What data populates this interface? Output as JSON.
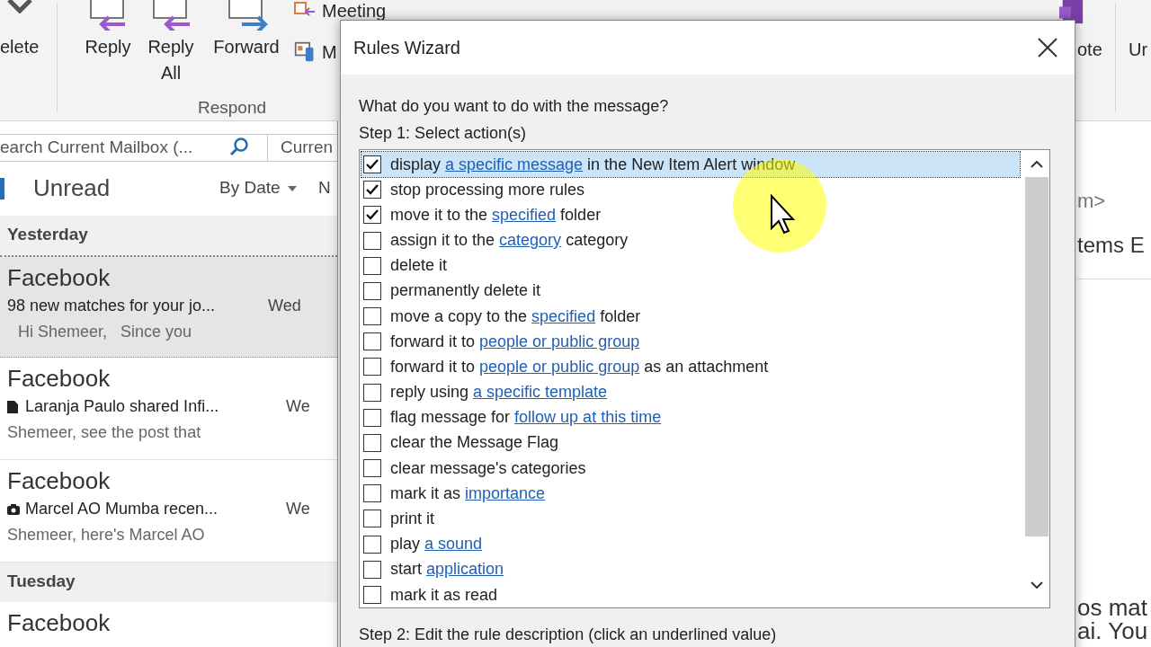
{
  "ribbon": {
    "buttons": [
      {
        "label": "elete",
        "kind": "delete"
      },
      {
        "label": "Reply",
        "kind": "reply"
      },
      {
        "label": "Reply All",
        "kind": "reply_all"
      },
      {
        "label": "Forward",
        "kind": "forward"
      }
    ],
    "small_buttons": [
      {
        "label": "Meeting",
        "kind": "meeting"
      },
      {
        "label": "M",
        "kind": "im"
      }
    ],
    "group_label": "Respond",
    "right_buttons": [
      {
        "label": "ote"
      },
      {
        "label": "Ur"
      }
    ]
  },
  "search": {
    "placeholder": "earch Current Mailbox (...",
    "scope": "Curren"
  },
  "filter": {
    "label": "Unread",
    "sort": "By Date",
    "next": "N"
  },
  "groups": [
    {
      "label": "Yesterday",
      "messages": [
        {
          "sender": "Facebook",
          "subject": "98 new matches for your jo...",
          "date": "Wed",
          "preview": "Hi Shemeer,   Since you",
          "selected": true
        },
        {
          "sender": "Facebook",
          "kind": "document",
          "subject": "Laranja Paulo shared Infi...",
          "date": "We",
          "preview": "Shemeer, see the post that",
          "selected": false
        },
        {
          "sender": "Facebook",
          "kind": "camera",
          "subject": "Marcel AO Mumba recen...",
          "date": "We",
          "preview": "Shemeer, here's Marcel AO",
          "selected": false
        }
      ]
    },
    {
      "label": "Tuesday",
      "messages": [
        {
          "sender": "Facebook",
          "selected": false
        }
      ]
    }
  ],
  "reading_pane": [
    "m>",
    "tems E",
    "os mat",
    "ai. You"
  ],
  "dialog": {
    "title": "Rules Wizard",
    "question": "What do you want to do with the message?",
    "step1": "Step 1: Select action(s)",
    "actions": [
      {
        "checked": true,
        "selected": true,
        "parts": [
          {
            "text": "display "
          },
          {
            "text": "a specific message",
            "link": true
          },
          {
            "text": " in the New Item Alert window"
          }
        ]
      },
      {
        "checked": true,
        "selected": false,
        "parts": [
          {
            "text": "stop processing more rules"
          }
        ]
      },
      {
        "checked": true,
        "selected": false,
        "parts": [
          {
            "text": "move it to the "
          },
          {
            "text": "specified",
            "link": true
          },
          {
            "text": " folder"
          }
        ]
      },
      {
        "checked": false,
        "selected": false,
        "parts": [
          {
            "text": "assign it to the "
          },
          {
            "text": "category",
            "link": true
          },
          {
            "text": " category"
          }
        ]
      },
      {
        "checked": false,
        "selected": false,
        "parts": [
          {
            "text": "delete it"
          }
        ]
      },
      {
        "checked": false,
        "selected": false,
        "parts": [
          {
            "text": "permanently delete it"
          }
        ]
      },
      {
        "checked": false,
        "selected": false,
        "parts": [
          {
            "text": "move a copy to the "
          },
          {
            "text": "specified",
            "link": true
          },
          {
            "text": " folder"
          }
        ]
      },
      {
        "checked": false,
        "selected": false,
        "parts": [
          {
            "text": "forward it to "
          },
          {
            "text": "people or public group",
            "link": true
          }
        ]
      },
      {
        "checked": false,
        "selected": false,
        "parts": [
          {
            "text": "forward it to "
          },
          {
            "text": "people or public group",
            "link": true
          },
          {
            "text": " as an attachment"
          }
        ]
      },
      {
        "checked": false,
        "selected": false,
        "parts": [
          {
            "text": "reply using "
          },
          {
            "text": "a specific template",
            "link": true
          }
        ]
      },
      {
        "checked": false,
        "selected": false,
        "parts": [
          {
            "text": "flag message for "
          },
          {
            "text": "follow up at this time",
            "link": true
          }
        ]
      },
      {
        "checked": false,
        "selected": false,
        "parts": [
          {
            "text": "clear the Message Flag"
          }
        ]
      },
      {
        "checked": false,
        "selected": false,
        "parts": [
          {
            "text": "clear message's categories"
          }
        ]
      },
      {
        "checked": false,
        "selected": false,
        "parts": [
          {
            "text": "mark it as "
          },
          {
            "text": "importance",
            "link": true
          }
        ]
      },
      {
        "checked": false,
        "selected": false,
        "parts": [
          {
            "text": "print it"
          }
        ]
      },
      {
        "checked": false,
        "selected": false,
        "parts": [
          {
            "text": "play "
          },
          {
            "text": "a sound",
            "link": true
          }
        ]
      },
      {
        "checked": false,
        "selected": false,
        "parts": [
          {
            "text": "start "
          },
          {
            "text": "application",
            "link": true
          }
        ]
      },
      {
        "checked": false,
        "selected": false,
        "parts": [
          {
            "text": "mark it as read"
          }
        ]
      }
    ],
    "step2": "Step 2: Edit the rule description (click an underlined value)"
  }
}
